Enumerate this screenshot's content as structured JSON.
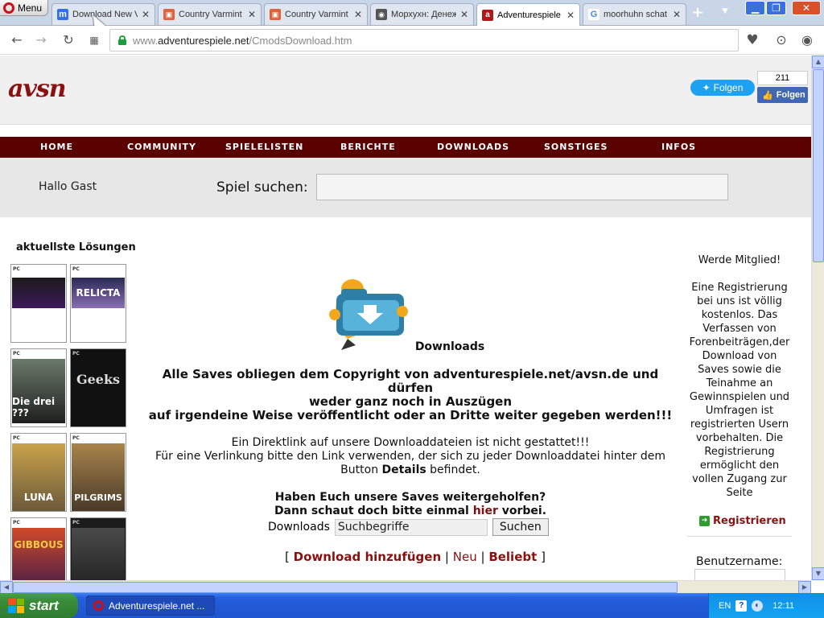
{
  "browser": {
    "menu_label": "Menu",
    "tabs": [
      {
        "label": "Download New V",
        "favicon_color": "#2f6ff0",
        "favicon_char": "m"
      },
      {
        "label": "Country Varmint",
        "favicon_color": "#e0623a",
        "favicon_char": "▣"
      },
      {
        "label": "Country Varmint",
        "favicon_color": "#e0623a",
        "favicon_char": "▣"
      },
      {
        "label": "Морхухн: Денежн",
        "favicon_color": "#555555",
        "favicon_char": "◉"
      },
      {
        "label": "Adventurespiele",
        "favicon_color": "#b01818",
        "favicon_char": "a"
      },
      {
        "label": "moorhuhn schat",
        "favicon_color": "#4285f4",
        "favicon_char": "G"
      }
    ],
    "new_tab_label": "+",
    "url_host": "www.adventurespiele.net",
    "url_path": "/CmodsDownload.htm",
    "url_prefix": "www.",
    "url_domain": "adventurespiele.net"
  },
  "header": {
    "logo_text": "avsn",
    "twitter_label": "Folgen",
    "fb_count": "211",
    "fb_label": "Folgen"
  },
  "nav": {
    "items": [
      "HOME",
      "COMMUNITY",
      "SPIELELISTEN",
      "BERICHTE",
      "DOWNLOADS",
      "SONSTIGES",
      "INFOS"
    ]
  },
  "search_band": {
    "greeting": "Hallo Gast",
    "search_label": "Spiel suchen:"
  },
  "left_sidebar": {
    "title": "aktuellste Lösungen",
    "thumbs": [
      {
        "art_text": "",
        "colors": [
          "#1a1a1a",
          "#3d1a5a"
        ]
      },
      {
        "art_text": "RELICTA",
        "colors": [
          "#2a2a55",
          "#8a6fb3"
        ]
      },
      {
        "art_text": "Die drei ???",
        "colors": [
          "#1f1f1f",
          "#c24a2a"
        ]
      },
      {
        "art_text": "Geeks",
        "colors": [
          "#111111",
          "#333333"
        ]
      },
      {
        "art_text": "LUNA",
        "colors": [
          "#6b5a3a",
          "#c9a24a"
        ]
      },
      {
        "art_text": "PILGRIMS",
        "colors": [
          "#4a3a2a",
          "#a8844a"
        ]
      },
      {
        "art_text": "GIBBOUS",
        "colors": [
          "#3a1a4a",
          "#d04a2a"
        ]
      },
      {
        "art_text": "",
        "colors": [
          "#1c1c1c",
          "#4a4a4a"
        ]
      }
    ]
  },
  "main": {
    "title": "Downloads",
    "copyright_1": "Alle Saves obliegen dem Copyright von adventurespiele.net/avsn.de und dürfen",
    "copyright_2": "weder ganz noch in Auszügen",
    "copyright_3": "auf irgendeine Weise veröffentlicht oder an Dritte weiter gegeben werden!!!",
    "note_1": "Ein Direktlink auf unsere Downloaddateien ist nicht gestattet!!!",
    "note_2": "Für eine Verlinkung bitte den Link verwenden, der sich zu jeder Downloaddatei hinter dem",
    "note_3a": "Button ",
    "note_3b": "Details",
    "note_3c": " befindet.",
    "help_1": "Haben Euch unsere Saves weitergeholfen?",
    "help_2a": "Dann schaut doch bitte einmal ",
    "help_2b": "hier",
    "help_2c": " vorbei.",
    "dl_label": "Downloads",
    "dl_search_value": "Suchbegriffe",
    "dl_button": "Suchen",
    "link_open": "[ ",
    "link_add": "Download hinzufügen",
    "link_sep1": " | ",
    "link_new": "Neu",
    "link_sep2": " | ",
    "link_popular": "Beliebt",
    "link_close": " ]"
  },
  "right_sidebar": {
    "heading": "Werde Mitglied!",
    "text": "Eine Registrierung bei uns ist völlig kostenlos. Das Verfassen von Forenbeiträgen,der Download von Saves sowie die Teinahme an Gewinnspielen und Umfragen ist registrierten Usern vorbehalten. Die Registrierung ermöglicht den vollen Zugang zur Seite",
    "register_label": "Registrieren",
    "username_label": "Benutzername:"
  },
  "taskbar": {
    "start_label": "start",
    "task_label": "Adventurespiele.net ...",
    "lang": "EN",
    "clock": "12:11"
  }
}
